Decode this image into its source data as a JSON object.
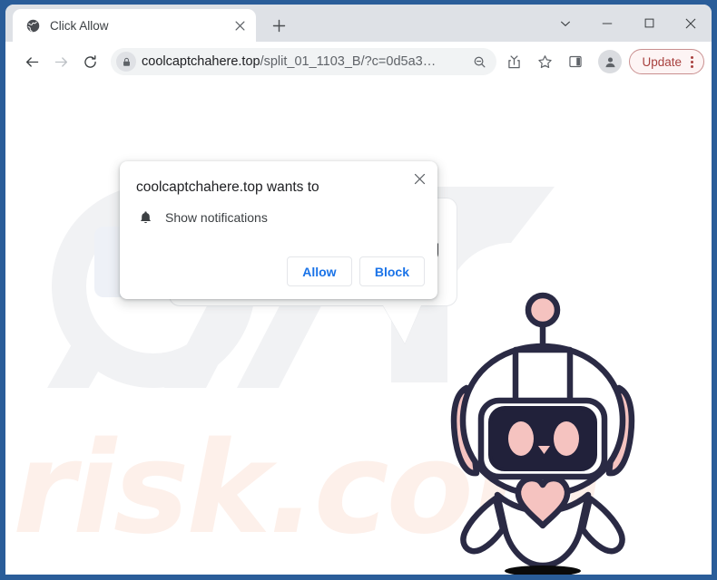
{
  "window": {
    "controls": [
      {
        "name": "tab-search",
        "glyph": "chevron-down-icon"
      },
      {
        "name": "minimize",
        "glyph": "minimize-icon"
      },
      {
        "name": "maximize",
        "glyph": "maximize-icon"
      },
      {
        "name": "close",
        "glyph": "close-icon"
      }
    ]
  },
  "tab": {
    "title": "Click Allow",
    "favicon": "globe-icon",
    "close_label": "×",
    "new_tab_label": "+"
  },
  "toolbar": {
    "back": "back-arrow-icon",
    "forward": "forward-arrow-icon",
    "reload": "reload-icon",
    "lock": "lock-icon",
    "url_main": "coolcaptchahere.top",
    "url_tail": "/split_01_1103_B/?c=0d5a3…",
    "url_full": "coolcaptchahere.top/split_01_1103_B/?c=0d5a3…",
    "zoom_out": "zoom-out-icon",
    "share": "share-icon",
    "bookmark": "star-icon",
    "side_panel": "side-panel-icon",
    "profile": "profile-avatar-icon",
    "update_label": "Update",
    "update_menu": "kebab-menu-icon"
  },
  "dialog": {
    "title": "coolcaptchahere.top wants to",
    "permission_icon": "bell-icon",
    "permission_label": "Show notifications",
    "allow_label": "Allow",
    "block_label": "Block",
    "close_label": "×"
  },
  "page": {
    "speech_bubble_text": "YOU",
    "watermark_top": "PC",
    "watermark_bottom": "risk.com",
    "mascot": "robot-mascot-illustration"
  },
  "colors": {
    "window_frame": "#2a5d99",
    "tab_strip": "#dee1e6",
    "omnibox": "#f1f3f4",
    "accent_blue": "#1a73e8",
    "update_red": "#a8403e",
    "robot_outline": "#2a2a44",
    "robot_pink": "#f5c3c0",
    "watermark_pink": "#fdf0ea",
    "watermark_gray": "#f1f2f4"
  }
}
